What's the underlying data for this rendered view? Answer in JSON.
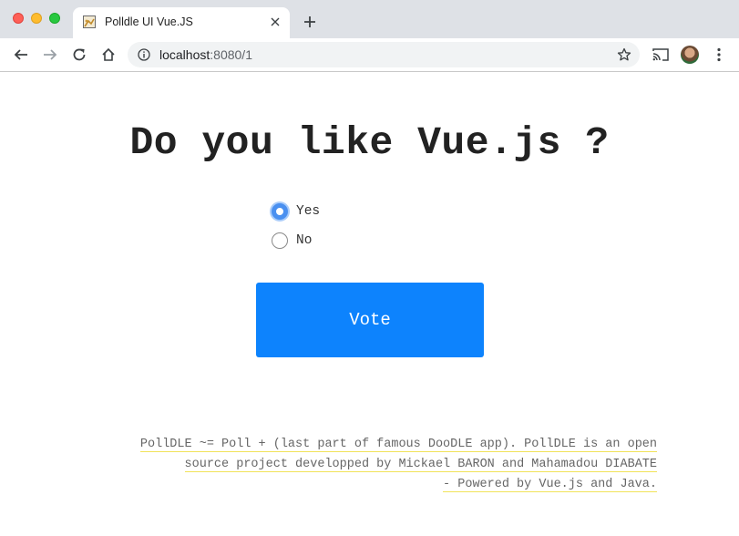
{
  "browser": {
    "tab_title": "Polldle UI Vue.JS",
    "url_host": "localhost",
    "url_rest": ":8080/1",
    "icons": {
      "back": "arrow-left-icon",
      "forward": "arrow-right-icon",
      "reload": "reload-icon",
      "home": "home-icon",
      "info": "info-icon",
      "bookmark": "star-icon",
      "cast": "cast-icon",
      "menu": "kebab-menu-icon",
      "close_tab": "close-icon",
      "new_tab": "plus-icon"
    }
  },
  "poll": {
    "question": "Do you like Vue.js ?",
    "options": [
      {
        "label": "Yes",
        "selected": true
      },
      {
        "label": "No",
        "selected": false
      }
    ],
    "vote_label": "Vote"
  },
  "footer": {
    "line1": "PollDLE ~= Poll + (last part of famous DooDLE app). PollDLE is an open",
    "line2": "source project developped by Mickael BARON and Mahamadou DIABATE",
    "line3": "- Powered by Vue.js and Java."
  },
  "colors": {
    "vote_button": "#0d83fd",
    "radio_selected": "#4a90f0",
    "footer_underline": "#f1e35a"
  }
}
